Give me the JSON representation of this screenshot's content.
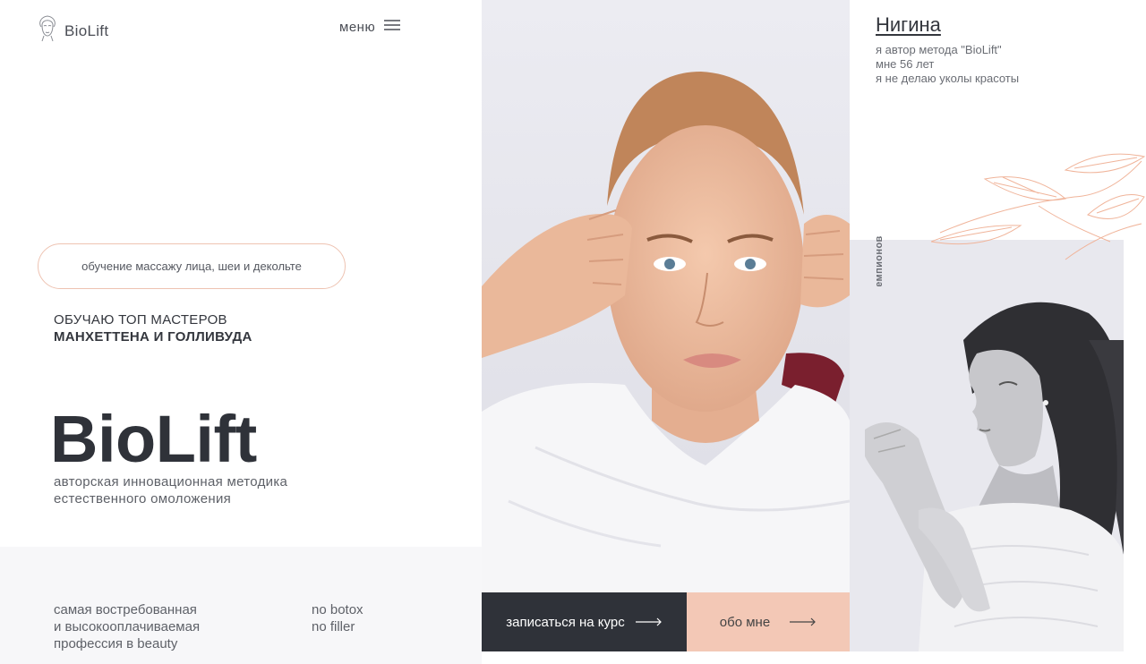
{
  "header": {
    "logo_text": "BioLift",
    "menu_label": "меню",
    "icons": {
      "logo": "face-outline-icon",
      "menu": "hamburger-icon"
    }
  },
  "hero": {
    "course_pill": "обучение массажу лица, шеи и декольте",
    "tagline_line1": "ОБУЧАЮ ТОП МАСТЕРОВ",
    "tagline_line2": "МАНХЕТТЕНА И ГОЛЛИВУДА",
    "title": "BioLift",
    "subtitle_line1": "авторская инновационная методика",
    "subtitle_line2": "естественного омоложения"
  },
  "footer_left": {
    "profession_line1": "самая востребованная",
    "profession_line2": "и высокооплачиваемая",
    "profession_line3": "профессия в beauty",
    "no_botox": "no botox",
    "no_filler": "no filler"
  },
  "buttons": {
    "signup_label": "записаться на курс",
    "about_label": "обо мне",
    "arrow_icon": "long-arrow-right-icon"
  },
  "author": {
    "name": "Нигина",
    "line1": "я автор метода \"BioLift\"",
    "line2": "мне 56 лет",
    "line3": "я не делаю уколы красоты",
    "vertical_text": "я готовлю чемпионов"
  },
  "colors": {
    "accent_peach": "#f3c8b6",
    "dark_button": "#2f3239",
    "pill_border": "#eec3b2",
    "leaf_stroke": "#f0b49a"
  }
}
